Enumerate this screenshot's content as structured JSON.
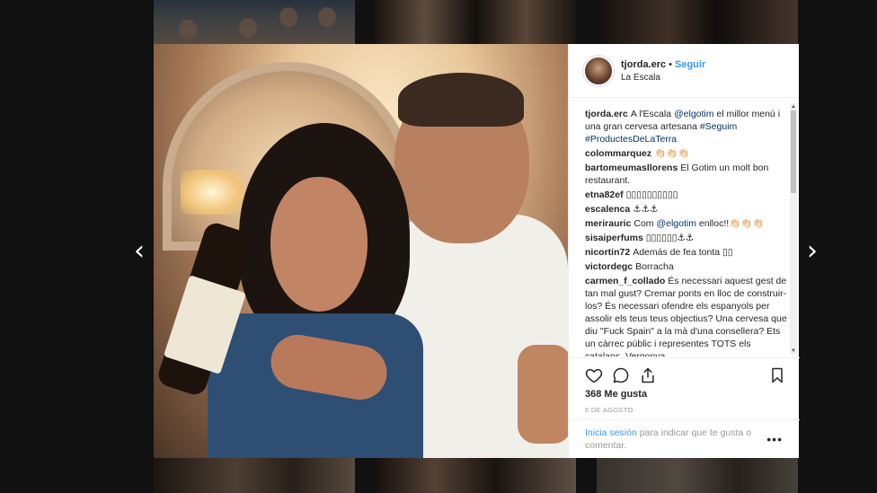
{
  "post": {
    "username": "tjorda.erc",
    "separator": "•",
    "follow_label": "Seguir",
    "location": "La Escala",
    "likes": "368 Me gusta",
    "date": "6 DE AGOSTO",
    "login_link": "Inicia sesión",
    "login_text": " para indicar que te gusta o comentar.",
    "more_label": "•••"
  },
  "caption": {
    "user": "tjorda.erc",
    "text1": "A l'Escala ",
    "mention": "@elgotim",
    "text2": " el millor menú i una gran cervesa artesana ",
    "tag1": "#Seguim",
    "tag2": "#ProductesDeLaTerra"
  },
  "comments": [
    {
      "user": "colommarquez",
      "text": "👏🏻👏🏻👏🏻"
    },
    {
      "user": "bartomeumasllorens",
      "text": "El Gotim un molt bon restaurant."
    },
    {
      "user": "etna82ef",
      "text": "▯▯▯▯▯▯▯▯▯▯"
    },
    {
      "user": "escalenca",
      "text": "⚓⚓⚓"
    },
    {
      "user": "merirauric",
      "text_before": "Com ",
      "mention": "@elgotim",
      "text_after": " enlloc!!👏🏻👏🏻👏🏻"
    },
    {
      "user": "sisaiperfums",
      "text": "▯▯▯▯▯▯⚓⚓"
    },
    {
      "user": "nicortin72",
      "text": "Además de fea tonta ▯▯"
    },
    {
      "user": "victordegc",
      "text": "Borracha"
    },
    {
      "user": "carmen_f_collado",
      "text": "És necessari aquest gest de tan mal gust? Cremar ponts en lloc de construir-los? És necessari ofendre els espanyols per assolir els teus teus objectius? Una cervesa que diu \"Fuck Spain\" a la mà d'una consellera? Ets un càrrec públic i representes TOTS els catalans. Vergonya."
    }
  ],
  "icons": {
    "like": "heart-icon",
    "comment": "comment-icon",
    "share": "share-icon",
    "save": "bookmark-icon",
    "prev": "chevron-left-icon",
    "next": "chevron-right-icon"
  },
  "nav": {
    "prev": "‹",
    "next": "›"
  },
  "colors": {
    "link_blue": "#3897f0",
    "text": "#262626",
    "muted": "#999999",
    "border": "#efefef"
  }
}
